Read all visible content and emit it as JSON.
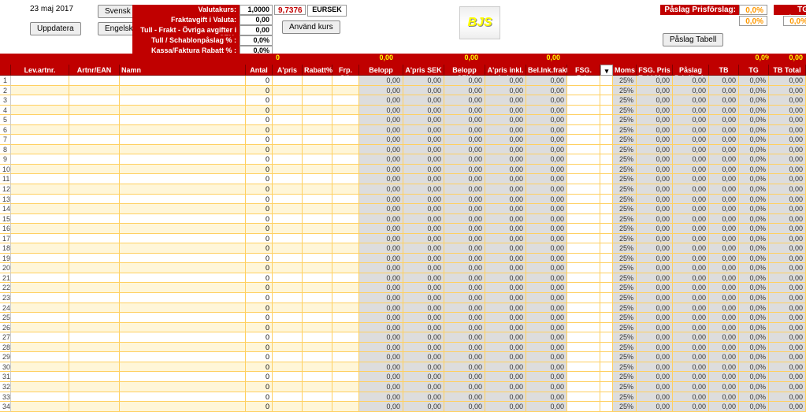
{
  "date": "23 maj 2017",
  "buttons": {
    "update": "Uppdatera",
    "svensk": "Svensk",
    "engelsk": "Engelsk",
    "anvand_kurs": "Använd kurs",
    "paslag_tabell": "Påslag Tabell"
  },
  "settings": [
    {
      "label": "Valutakurs:",
      "value": "1,0000"
    },
    {
      "label": "Fraktavgift i Valuta:",
      "value": "0,00"
    },
    {
      "label": "Tull - Frakt - Övriga avgifter i SEK:",
      "value": "0,00"
    },
    {
      "label": "Tull / Schablonpåslag  % :",
      "value": "0,0%"
    },
    {
      "label": "Kassa/Faktura Rabatt % :",
      "value": "0,0%"
    }
  ],
  "rate": "9,7376",
  "pair": "EURSEK",
  "logo": "BJS",
  "paslag": {
    "label": "Påslag Prisförslag:",
    "value": "0,0%",
    "extra": "0,0%"
  },
  "tg_alarm": {
    "label": "TG Alarm:",
    "value": "0,0%"
  },
  "totals": {
    "antal": "0",
    "belopp": "0,00",
    "belopp_sek": "0,00",
    "bel_ink_frakt": "0,00",
    "fsg_pris": "",
    "tg": "0,0%",
    "tb_total": "0,00"
  },
  "headers": [
    "",
    "Lev.artnr.",
    "Artnr/EAN",
    "Namn",
    "Antal",
    "A'pris",
    "Rabatt%",
    "Frp. Stl.",
    "Belopp",
    "A'pris SEK",
    "Belopp SEK",
    "A'pris inkl. frakt",
    "Bel.Ink.frakt",
    "FSG. Pris inkl. moms",
    "",
    "Moms",
    "FSG. Pris Exkl.Moms",
    "Påslag Prisförslag",
    "TB",
    "TG",
    "TB Total"
  ],
  "row_defaults": {
    "antal": "0",
    "belopp": "0,00",
    "apris_sek": "0,00",
    "belopp_sek": "0,00",
    "apris_inkl": "0,00",
    "bel_ink": "0,00",
    "moms": "25%",
    "fsg_exkl": "0,00",
    "paslag": "0,00",
    "tb": "0,00",
    "tg": "0,0%",
    "tb_total": "0,00"
  },
  "row_count": 34
}
